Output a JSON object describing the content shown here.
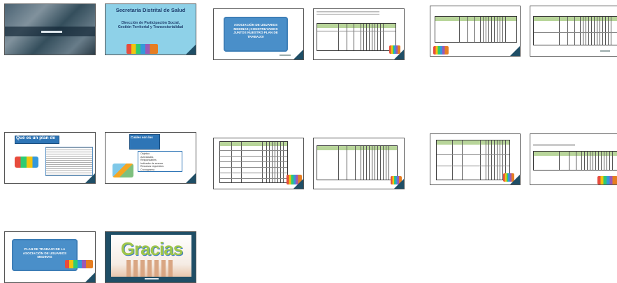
{
  "slides": [
    {
      "id": 1
    },
    {
      "id": 2,
      "title": "Secretaría Distrital de Salud",
      "subtitle": "Dirección de Participación Social, Gestión Territorial y Transectorialidad"
    },
    {
      "id": 3,
      "scroll_text": "ASOCIACIÓN DE USUARIOS MEDINAS ¡CONSTRUYAMOS JUNTOS NUESTRO PLAN DE TRABAJO!"
    },
    {
      "id": 4
    },
    {
      "id": 5
    },
    {
      "id": 6
    },
    {
      "id": 7,
      "title": "Qué es un plan de"
    },
    {
      "id": 8,
      "title": "Cuáles son los",
      "items": [
        "Objetivo",
        "Actividades",
        "Responsables",
        "Indicador de avance",
        "Recursos requeridos",
        "Cronograma"
      ]
    },
    {
      "id": 9
    },
    {
      "id": 10
    },
    {
      "id": 11
    },
    {
      "id": 12
    },
    {
      "id": 13,
      "scroll_text": "PLAN DE TRABAJO DE LA ASOCIACIÓN DE USUARIOS MEDINAS"
    },
    {
      "id": 14,
      "word": "Gracias"
    }
  ],
  "colors": {
    "teal": "#1f4e66",
    "header_green": "#b8d59a",
    "slide_blue": "#2e75b6",
    "light_blue_bg": "#8ed1e8"
  }
}
